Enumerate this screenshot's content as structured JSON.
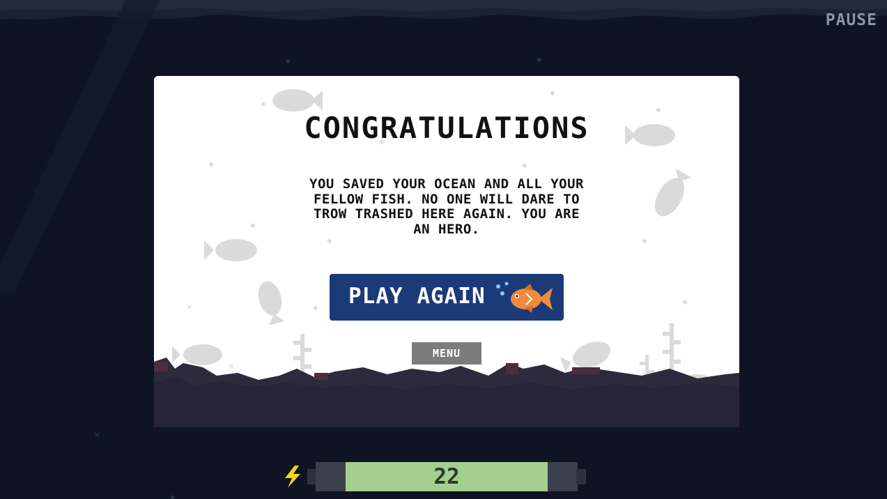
{
  "header": {
    "pause_label": "PAUSE"
  },
  "dialog": {
    "title": "CONGRATULATIONS",
    "message": "YOU SAVED YOUR OCEAN AND ALL YOUR FELLOW FISH. NO ONE WILL DARE TO TROW TRASHED HERE AGAIN. YOU ARE AN HERO.",
    "play_again_label": "PLAY AGAIN",
    "menu_label": "MENU"
  },
  "hud": {
    "energy_value": "22",
    "energy_icon": "lightning-bolt-icon",
    "energy_fill_fraction": 0.73
  },
  "colors": {
    "background": "#0e1424",
    "panel": "#ffffff",
    "play_button": "#1b3a78",
    "menu_button": "#7c7c7c",
    "energy_fill": "#a3cf8f",
    "seabed": "#2e2a3d",
    "fish_orange": "#f08a3c"
  }
}
